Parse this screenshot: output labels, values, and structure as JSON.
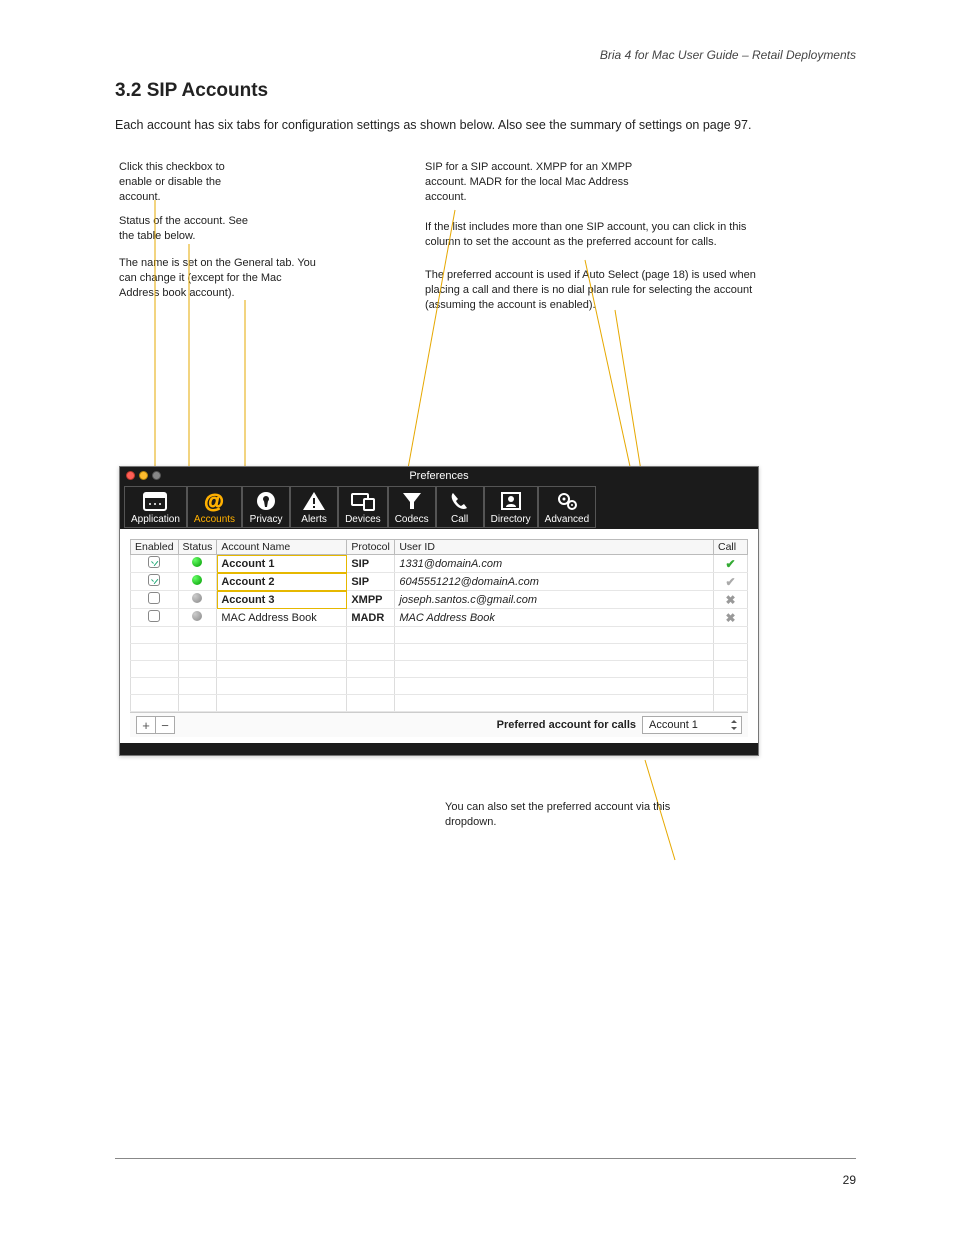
{
  "doc": {
    "header_right": "Bria 4 for Mac User Guide – Retail Deployments",
    "section_title": "3.2 SIP Accounts",
    "intro_para": "Each account has six tabs for configuration settings as shown below. Also see the summary of settings on page 97.",
    "page_num": "29"
  },
  "window": {
    "title": "Preferences",
    "traffic": [
      "red",
      "yellow",
      "gray"
    ],
    "tabs": [
      {
        "id": "application",
        "label": "Application",
        "icon": "calendar"
      },
      {
        "id": "accounts",
        "label": "Accounts",
        "icon": "at",
        "selected": true
      },
      {
        "id": "privacy",
        "label": "Privacy",
        "icon": "keyhole"
      },
      {
        "id": "alerts",
        "label": "Alerts",
        "icon": "warn"
      },
      {
        "id": "devices",
        "label": "Devices",
        "icon": "devices"
      },
      {
        "id": "codecs",
        "label": "Codecs",
        "icon": "funnel"
      },
      {
        "id": "call",
        "label": "Call",
        "icon": "phone"
      },
      {
        "id": "directory",
        "label": "Directory",
        "icon": "person"
      },
      {
        "id": "advanced",
        "label": "Advanced",
        "icon": "gears"
      }
    ],
    "columns": {
      "enabled": "Enabled",
      "status": "Status",
      "name": "Account Name",
      "protocol": "Protocol",
      "user": "User ID",
      "call": "Call"
    },
    "rows": [
      {
        "enabled": true,
        "status": "green",
        "name": "Account 1",
        "name_bold": true,
        "protocol": "SIP",
        "user": "1331@domainA.com",
        "user_ital": true,
        "call": "tick",
        "highlight_name": true
      },
      {
        "enabled": true,
        "status": "green",
        "name": "Account 2",
        "name_bold": true,
        "protocol": "SIP",
        "user": "6045551212@domainA.com",
        "user_ital": true,
        "call": "tick-dim",
        "highlight_name": true
      },
      {
        "enabled": false,
        "status": "gray",
        "name": "Account 3",
        "name_bold": true,
        "protocol": "XMPP",
        "user": "joseph.santos.c@gmail.com",
        "user_ital": true,
        "call": "x",
        "highlight_name": true
      },
      {
        "enabled": false,
        "status": "gray",
        "name": "MAC Address Book",
        "name_bold": false,
        "protocol": "MADR",
        "user": "MAC Address Book",
        "user_ital": true,
        "call": "x",
        "highlight_name": false
      }
    ],
    "empty_rows": 5,
    "footer": {
      "add": "+",
      "remove": "−",
      "pref_label": "Preferred account for calls",
      "pref_value": "Account 1"
    }
  },
  "callouts": {
    "c1": "Click this checkbox to enable or disable the account.",
    "c2": "Status of the account. See the table below.",
    "c3": "The name is set on the General tab. You can change it (except for the Mac Address book account).",
    "c4": "SIP for a SIP account. XMPP for an XMPP account. MADR for the local Mac Address account.",
    "c5": "If the list includes more than one SIP account, you can click in this column to set the account as the preferred account for calls.",
    "c6": "The preferred account is used if Auto Select (page 18) is used when placing a call and there is no dial plan rule for selecting the account (assuming the account is enabled).",
    "c7": "You can also set the preferred account via this dropdown."
  }
}
